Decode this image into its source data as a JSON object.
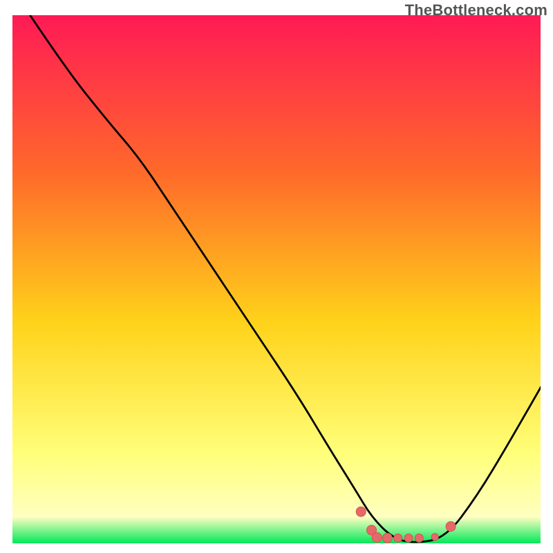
{
  "watermark": "TheBottleneck.com",
  "colors": {
    "gradient_top": "#ff1a55",
    "gradient_mid_upper": "#ff6a2a",
    "gradient_mid": "#ffd21a",
    "gradient_lower": "#ffff7a",
    "gradient_bottom_band": "#ffffc0",
    "gradient_bottom": "#00e85a",
    "curve": "#000000",
    "marker_fill": "#e46a6a",
    "marker_stroke": "#d94f4f"
  },
  "chart_data": {
    "type": "line",
    "title": "",
    "xlabel": "",
    "ylabel": "",
    "ylim": [
      0,
      1
    ],
    "series": [
      {
        "name": "curve",
        "x": [
          0.02,
          0.1,
          0.18,
          0.24,
          0.3,
          0.38,
          0.46,
          0.54,
          0.6,
          0.65,
          0.68,
          0.72,
          0.76,
          0.82,
          0.88,
          0.94,
          1.02
        ],
        "y": [
          1.02,
          0.9,
          0.8,
          0.73,
          0.64,
          0.52,
          0.4,
          0.28,
          0.18,
          0.1,
          0.05,
          0.01,
          0.0,
          0.01,
          0.09,
          0.19,
          0.33
        ]
      }
    ],
    "markers": {
      "name": "highlight-cluster",
      "points": [
        {
          "x": 0.66,
          "y": 0.06,
          "r": 7
        },
        {
          "x": 0.68,
          "y": 0.025,
          "r": 7
        },
        {
          "x": 0.69,
          "y": 0.011,
          "r": 7
        },
        {
          "x": 0.71,
          "y": 0.01,
          "r": 7
        },
        {
          "x": 0.73,
          "y": 0.01,
          "r": 6
        },
        {
          "x": 0.75,
          "y": 0.01,
          "r": 6
        },
        {
          "x": 0.77,
          "y": 0.01,
          "r": 6
        },
        {
          "x": 0.8,
          "y": 0.012,
          "r": 5
        },
        {
          "x": 0.83,
          "y": 0.032,
          "r": 7
        }
      ]
    }
  }
}
